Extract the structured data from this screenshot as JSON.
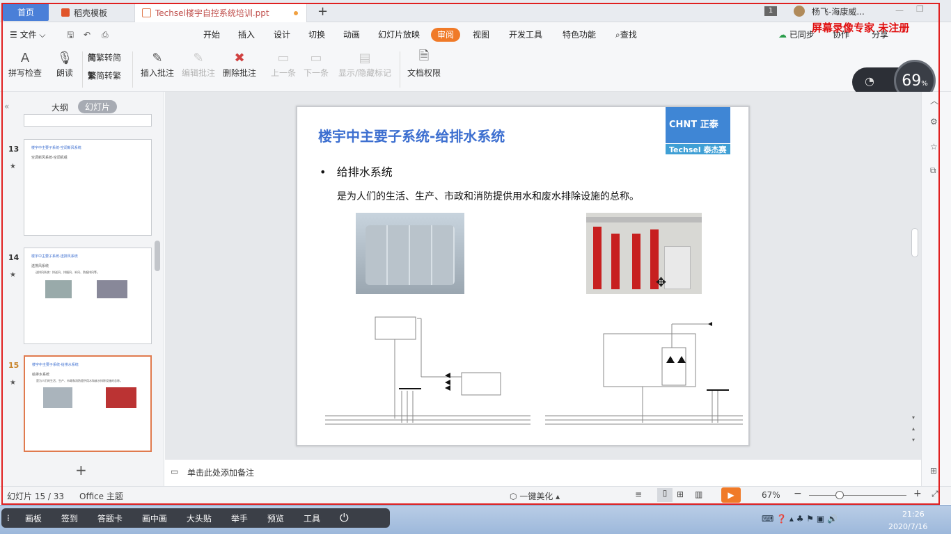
{
  "tabs": {
    "home": "首页",
    "template": "稻壳模板",
    "doc": "Techsel楼宇自控系统培训.ppt",
    "add": "+",
    "window_badge": "1",
    "user": "杨飞-海康威..."
  },
  "menu": {
    "file": "文件",
    "items": [
      "开始",
      "插入",
      "设计",
      "切换",
      "动画",
      "幻灯片放映",
      "审阅",
      "视图",
      "开发工具",
      "特色功能"
    ],
    "search": "查找",
    "synced": "已同步",
    "collab": "协作",
    "share": "分享"
  },
  "watermark": "屏幕录像专家 未注册",
  "ribbon": {
    "spell": "拼写检查",
    "read": "朗读",
    "trad": "繁转简",
    "simp": "简转繁",
    "insert_comment": "插入批注",
    "edit_comment": "编辑批注",
    "delete_comment": "删除批注",
    "prev": "上一条",
    "next": "下一条",
    "show_hide": "显示/隐藏标记",
    "perm": "文档权限"
  },
  "net_widget": {
    "percent": "69",
    "unit": "%"
  },
  "panel": {
    "outline": "大纲",
    "slides": "幻灯片",
    "add": "+"
  },
  "thumbs": [
    {
      "num": "13",
      "title": "楼宇中主要子系统-空调新风系统",
      "bullet": "空调新风系统-空调机组"
    },
    {
      "num": "14",
      "title": "楼宇中主要子系统-送排风系统",
      "bullet": "送排风系统",
      "text": "送排风系统：排送风、排烟风、补风、防烟排风等。"
    },
    {
      "num": "15",
      "title": "楼宇中主要子系统-给排水系统",
      "bullet": "给排水系统",
      "text": "是为人们的生活、生产、市政和消防提供用水和废水排除设施的总称。"
    }
  ],
  "slide": {
    "title": "楼宇中主要子系统-给排水系统",
    "logo_top": "CHNT 正泰",
    "logo_bottom": "Techsel 泰杰赛",
    "bullet": "给排水系统",
    "text": "是为人们的生活、生产、市政和消防提供用水和废水排除设施的总称。"
  },
  "notes": "单击此处添加备注",
  "status": {
    "slide_count": "幻灯片 15 / 33",
    "theme": "Office 主题",
    "beautify": "一键美化",
    "zoom": "67%"
  },
  "taskbar": {
    "tools": [
      "画板",
      "签到",
      "答题卡",
      "画中画",
      "大头贴",
      "举手",
      "预览",
      "工具"
    ],
    "time": "21:26",
    "date": "2020/7/16"
  },
  "colors": {
    "accent": "#f07a28",
    "slide_title": "#3d6fd0",
    "home_tab": "#4a7fd8",
    "watermark": "#e01010"
  }
}
